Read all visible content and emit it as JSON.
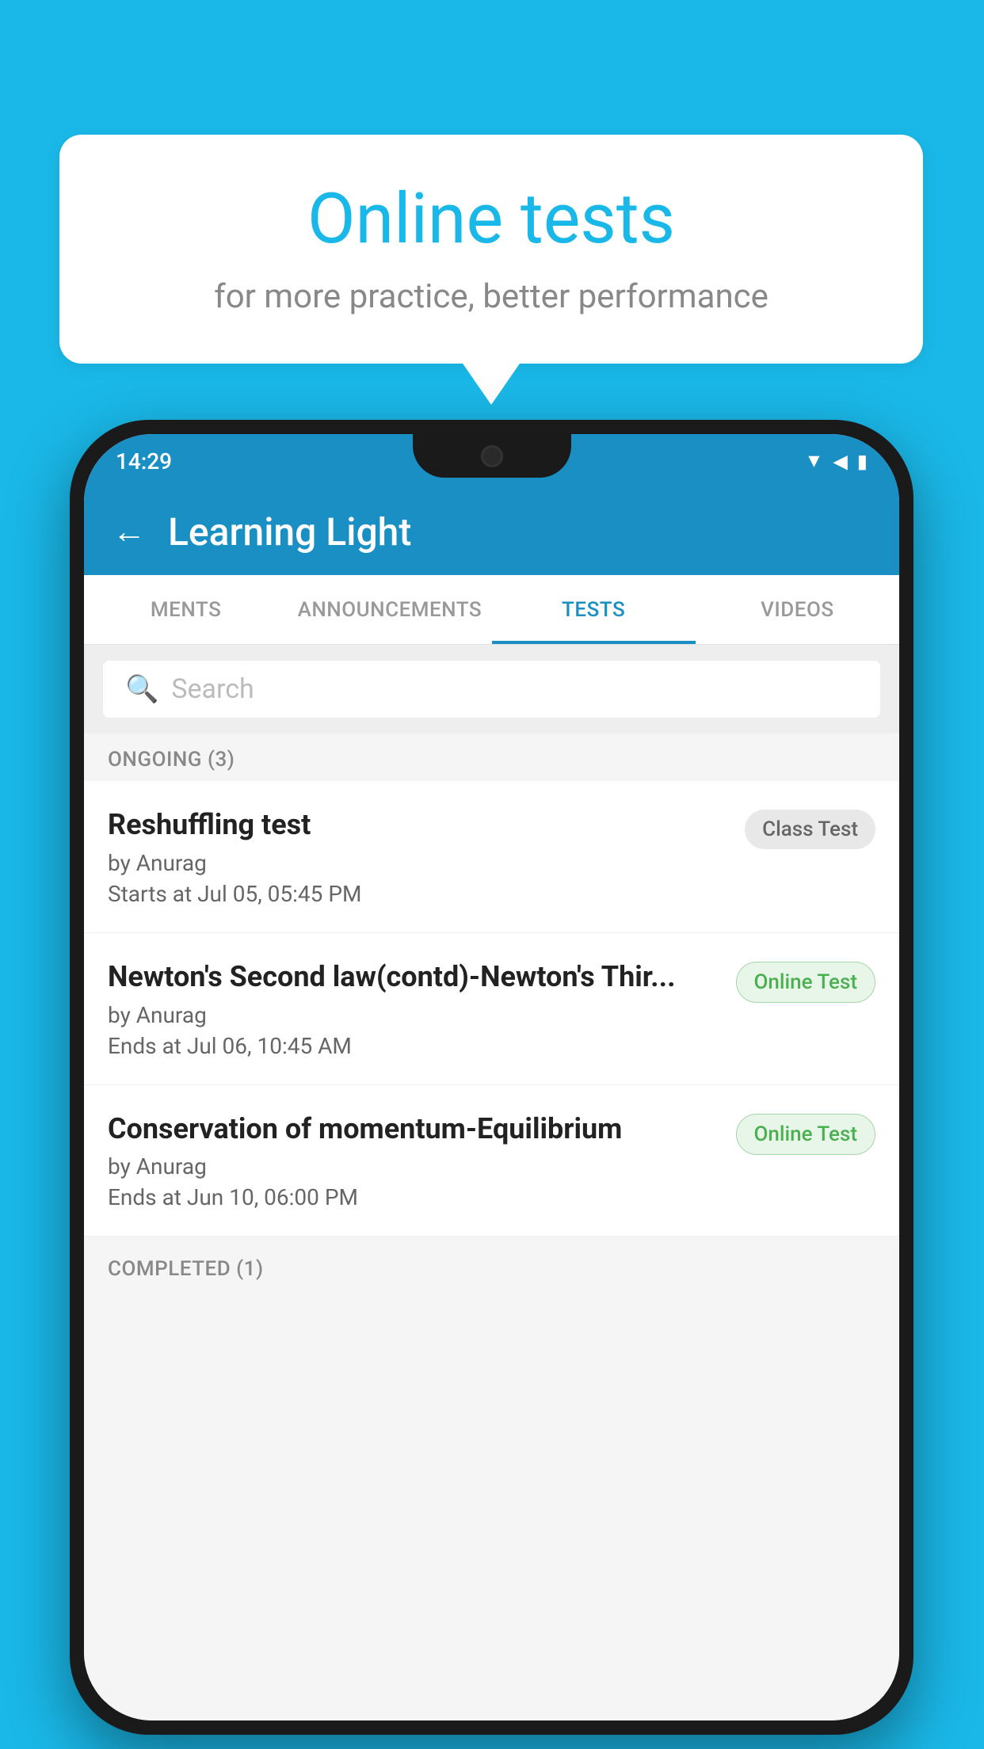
{
  "background_color": "#1ab8e8",
  "bubble": {
    "title": "Online tests",
    "subtitle": "for more practice, better performance"
  },
  "phone": {
    "status_bar": {
      "time": "14:29"
    },
    "app_header": {
      "title": "Learning Light",
      "back_label": "←"
    },
    "tabs": [
      {
        "label": "MENTS",
        "active": false
      },
      {
        "label": "ANNOUNCEMENTS",
        "active": false
      },
      {
        "label": "TESTS",
        "active": true
      },
      {
        "label": "VIDEOS",
        "active": false
      }
    ],
    "search": {
      "placeholder": "Search"
    },
    "ongoing_section": {
      "label": "ONGOING (3)"
    },
    "test_items": [
      {
        "name": "Reshuffling test",
        "author": "by Anurag",
        "time_label": "Starts at",
        "time": "Jul 05, 05:45 PM",
        "badge": "Class Test",
        "badge_type": "class"
      },
      {
        "name": "Newton's Second law(contd)-Newton's Thir...",
        "author": "by Anurag",
        "time_label": "Ends at",
        "time": "Jul 06, 10:45 AM",
        "badge": "Online Test",
        "badge_type": "online"
      },
      {
        "name": "Conservation of momentum-Equilibrium",
        "author": "by Anurag",
        "time_label": "Ends at",
        "time": "Jun 10, 06:00 PM",
        "badge": "Online Test",
        "badge_type": "online"
      }
    ],
    "completed_section": {
      "label": "COMPLETED (1)"
    }
  }
}
